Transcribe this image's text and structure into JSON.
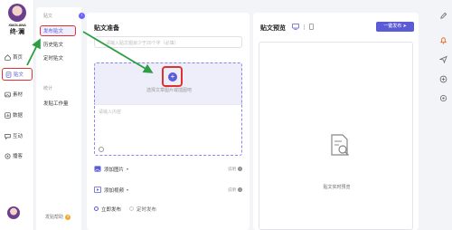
{
  "brand": {
    "name_en": "XIAOLANA",
    "name_cn": "终·澜"
  },
  "rail": {
    "items": [
      {
        "label": "首页",
        "icon": "home-icon"
      },
      {
        "label": "贴文",
        "icon": "post-icon"
      },
      {
        "label": "素材",
        "icon": "image-icon"
      },
      {
        "label": "数据",
        "icon": "data-icon"
      },
      {
        "label": "互动",
        "icon": "chat-icon"
      },
      {
        "label": "播客",
        "icon": "podcast-icon"
      }
    ]
  },
  "submenu": {
    "section_post": "贴文",
    "items": [
      "发布贴文",
      "历史贴文",
      "定时贴文"
    ],
    "section_stats": "统计",
    "stats_items": [
      "发贴工作量"
    ],
    "help": "发贴帮助",
    "help_badge": "?"
  },
  "editor": {
    "title": "贴文准备",
    "title_placeholder": "请输入贴文题目少于20个字（必填）",
    "upload_hint": "选择文章图片或插图吧",
    "body_placeholder": "请输入内容",
    "add_image": "添加图片",
    "add_video": "添加视频",
    "note_label": "说明",
    "publish_now": "立即发布",
    "schedule": "定时发布"
  },
  "preview": {
    "title": "贴文预览",
    "publish_button": "一键发布",
    "empty_text": "贴文实时预览"
  },
  "colors": {
    "accent": "#5b5bd6",
    "highlight": "#e03131",
    "arrow": "#2e9e44"
  }
}
